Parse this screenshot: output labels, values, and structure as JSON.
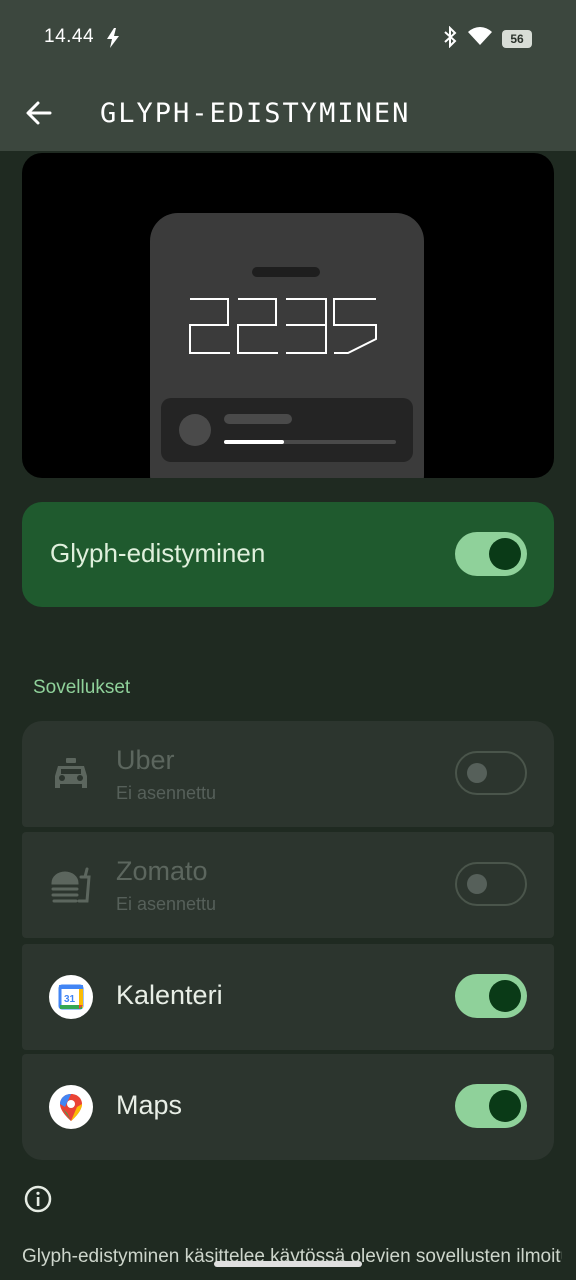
{
  "status_bar": {
    "time": "14.44",
    "battery": "56",
    "icons": [
      "charging-bolt-icon",
      "bluetooth-icon",
      "wifi-icon",
      "battery-icon"
    ]
  },
  "header": {
    "title": "GLYPH-EDISTYMINEN",
    "back_icon": "arrow-left-icon"
  },
  "preview": {
    "clock_digits": "2235",
    "progress": 0.35
  },
  "main_toggle": {
    "label": "Glyph-edistyminen",
    "enabled": true
  },
  "apps_section": {
    "label": "Sovellukset",
    "items": [
      {
        "name": "Uber",
        "subtitle": "Ei asennettu",
        "icon": "taxi-icon",
        "installed": false,
        "enabled": false
      },
      {
        "name": "Zomato",
        "subtitle": "Ei asennettu",
        "icon": "food-delivery-icon",
        "installed": false,
        "enabled": false
      },
      {
        "name": "Kalenteri",
        "subtitle": "",
        "icon": "google-calendar-icon",
        "calendar_day": "31",
        "installed": true,
        "enabled": true
      },
      {
        "name": "Maps",
        "subtitle": "",
        "icon": "google-maps-icon",
        "installed": true,
        "enabled": true
      }
    ]
  },
  "info": {
    "icon": "info-icon",
    "description": "Glyph-edistyminen käsittelee käytössä olevien sovellusten ilmoitukset ja antaa arvion edistymisestä. Saattaa kohdata"
  },
  "colors": {
    "background": "#1f2a21",
    "app_bar": "#3c473e",
    "toggle_card": "#1f5a2e",
    "accent": "#8fd19a",
    "row_bg": "#2c352e"
  }
}
